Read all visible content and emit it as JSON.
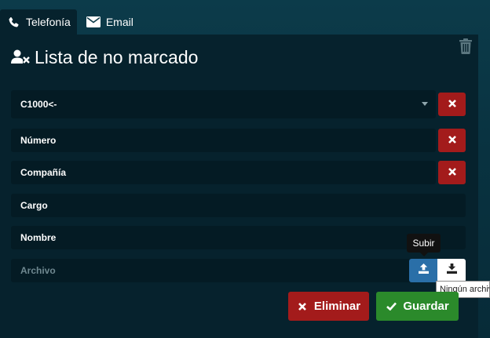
{
  "tabs": [
    {
      "label": "Telefonía",
      "icon": "phone-icon",
      "active": true
    },
    {
      "label": "Email",
      "icon": "envelope-icon",
      "active": false
    }
  ],
  "panel": {
    "title": "Lista de no marcado",
    "title_icon": "user-remove-icon",
    "trash_icon": "trash-icon"
  },
  "form": {
    "select_value": "C1000<-",
    "fields": {
      "numero_placeholder": "Número",
      "compania_placeholder": "Compañía",
      "cargo_placeholder": "Cargo",
      "nombre_placeholder": "Nombre",
      "archivo_placeholder": "Archivo"
    },
    "upload_tooltip": "Subir",
    "file_tooltip": "Ningún archivo seleccionado"
  },
  "actions": {
    "delete_label": "Eliminar",
    "save_label": "Guardar"
  },
  "colors": {
    "background": "#0c3b4a",
    "panel": "#06222d",
    "danger": "#a31b1b",
    "success": "#2b8a2b",
    "primary": "#2a6fa8"
  }
}
